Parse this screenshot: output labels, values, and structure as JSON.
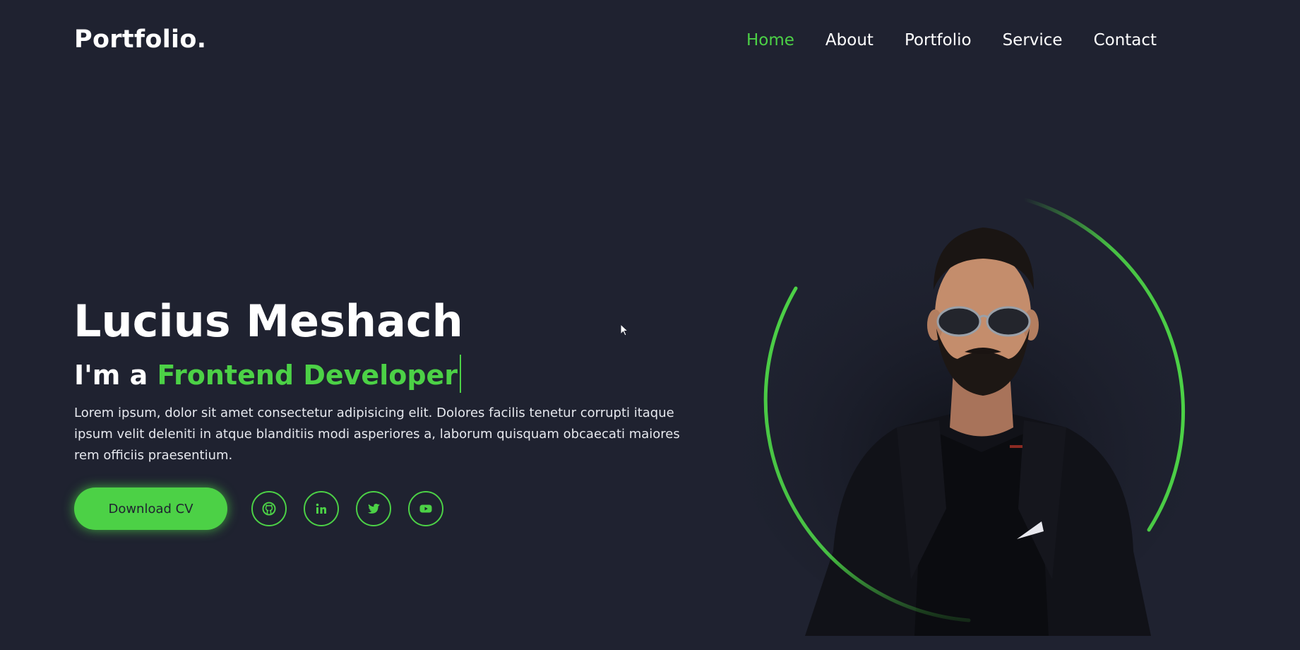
{
  "brand": {
    "logo": "Portfolio."
  },
  "nav": {
    "items": [
      {
        "label": "Home",
        "active": true
      },
      {
        "label": "About",
        "active": false
      },
      {
        "label": "Portfolio",
        "active": false
      },
      {
        "label": "Service",
        "active": false
      },
      {
        "label": "Contact",
        "active": false
      }
    ]
  },
  "hero": {
    "name": "Lucius Meshach",
    "role_prefix": "I'm a",
    "role_highlight": "Frontend Developer",
    "description": "Lorem ipsum, dolor sit amet consectetur adipisicing elit. Dolores facilis tenetur corrupti itaque ipsum velit deleniti in atque blanditiis modi asperiores a, laborum quisquam obcaecati maiores rem officiis praesentium.",
    "cv_button": "Download CV",
    "socials": [
      {
        "icon": "github-icon"
      },
      {
        "icon": "linkedin-icon"
      },
      {
        "icon": "twitter-icon"
      },
      {
        "icon": "youtube-icon"
      }
    ]
  },
  "colors": {
    "background": "#1f2230",
    "accent": "#4cd146",
    "text": "#ffffff"
  }
}
